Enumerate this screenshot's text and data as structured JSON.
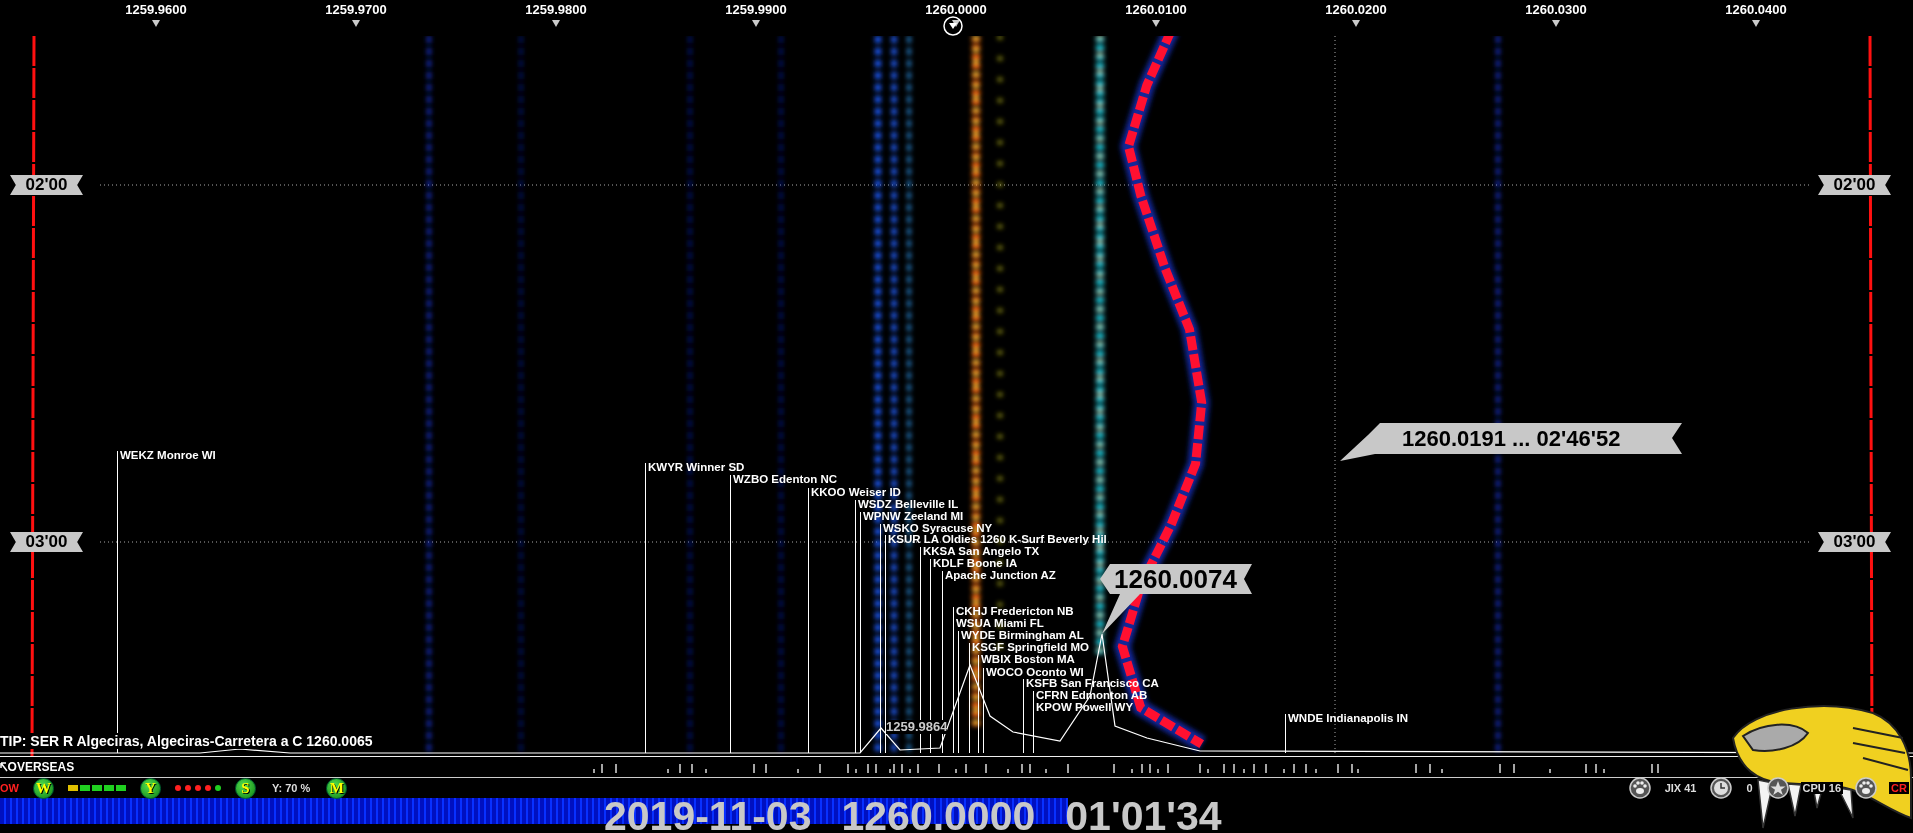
{
  "frequency_axis": {
    "ticks": [
      "1259.9600",
      "1259.9700",
      "1259.9800",
      "1259.9900",
      "1260.0000",
      "1260.0100",
      "1260.0200",
      "1260.0300",
      "1260.0400"
    ]
  },
  "time_marks": [
    {
      "left": "02'00",
      "right": "02'00"
    },
    {
      "left": "03'00",
      "right": "03'00"
    }
  ],
  "stations": [
    {
      "name": "WEKZ Monroe WI"
    },
    {
      "name": "KWYR Winner SD"
    },
    {
      "name": "WZBO Edenton NC"
    },
    {
      "name": "KKOO Weiser ID"
    },
    {
      "name": "WSDZ Belleville IL"
    },
    {
      "name": "WPNW Zeeland MI"
    },
    {
      "name": "WSKO Syracuse NY"
    },
    {
      "name": "KSUR LA Oldies 1260 K-Surf Beverly Hil"
    },
    {
      "name": "KKSA San Angelo TX"
    },
    {
      "name": "KDLF Boone IA"
    },
    {
      "name": "Apache Junction AZ"
    },
    {
      "name": "CKHJ Fredericton NB"
    },
    {
      "name": "WSUA Miami FL"
    },
    {
      "name": "WYDE Birmingham AL"
    },
    {
      "name": "KSGF Springfield MO"
    },
    {
      "name": "WBIX Boston MA"
    },
    {
      "name": "WOCO Oconto WI"
    },
    {
      "name": "KSFB San Francisco CA"
    },
    {
      "name": "CFRN Edmonton AB"
    },
    {
      "name": "KPOW Powell WY"
    },
    {
      "name": "WNDE Indianapolis IN"
    }
  ],
  "peak_label": "1259.9864",
  "frequency_callout": "1260.0074",
  "cursor_readout": "1260.0191 ... 02'46'52",
  "tip": "TIP: SER R Algeciras, Algeciras-Carretera a C 1260.0065",
  "overseas_label": "OVERSEAS",
  "status": {
    "mode": "OW",
    "volume": "Y: 70 %",
    "items": [
      {
        "kind": "button",
        "label": "W"
      },
      {
        "kind": "segments",
        "segments": [
          {
            "color": "#e0c000"
          },
          {
            "color": "#20d020"
          },
          {
            "color": "#20d020"
          },
          {
            "color": "#20d020"
          },
          {
            "color": "#20d020"
          }
        ]
      },
      {
        "kind": "button",
        "label": "Y"
      },
      {
        "kind": "dots",
        "dots": [
          {
            "color": "#ff2020"
          },
          {
            "color": "#ff2020"
          },
          {
            "color": "#ff2020"
          },
          {
            "color": "#ff2020"
          },
          {
            "color": "#20d020"
          }
        ]
      },
      {
        "kind": "button",
        "label": "S"
      },
      {
        "kind": "volume"
      },
      {
        "kind": "button",
        "label": "M"
      }
    ]
  },
  "tray": [
    {
      "kind": "paw"
    },
    {
      "kind": "text",
      "text": "JIX 41"
    },
    {
      "kind": "clock"
    },
    {
      "kind": "text",
      "text": "0"
    },
    {
      "kind": "star"
    },
    {
      "kind": "text",
      "text": "CPU 16"
    },
    {
      "kind": "paw"
    },
    {
      "kind": "alert",
      "text": "CR"
    }
  ],
  "date": "2019-11-03",
  "frequency": "1260.0000",
  "time": "01'01'34"
}
